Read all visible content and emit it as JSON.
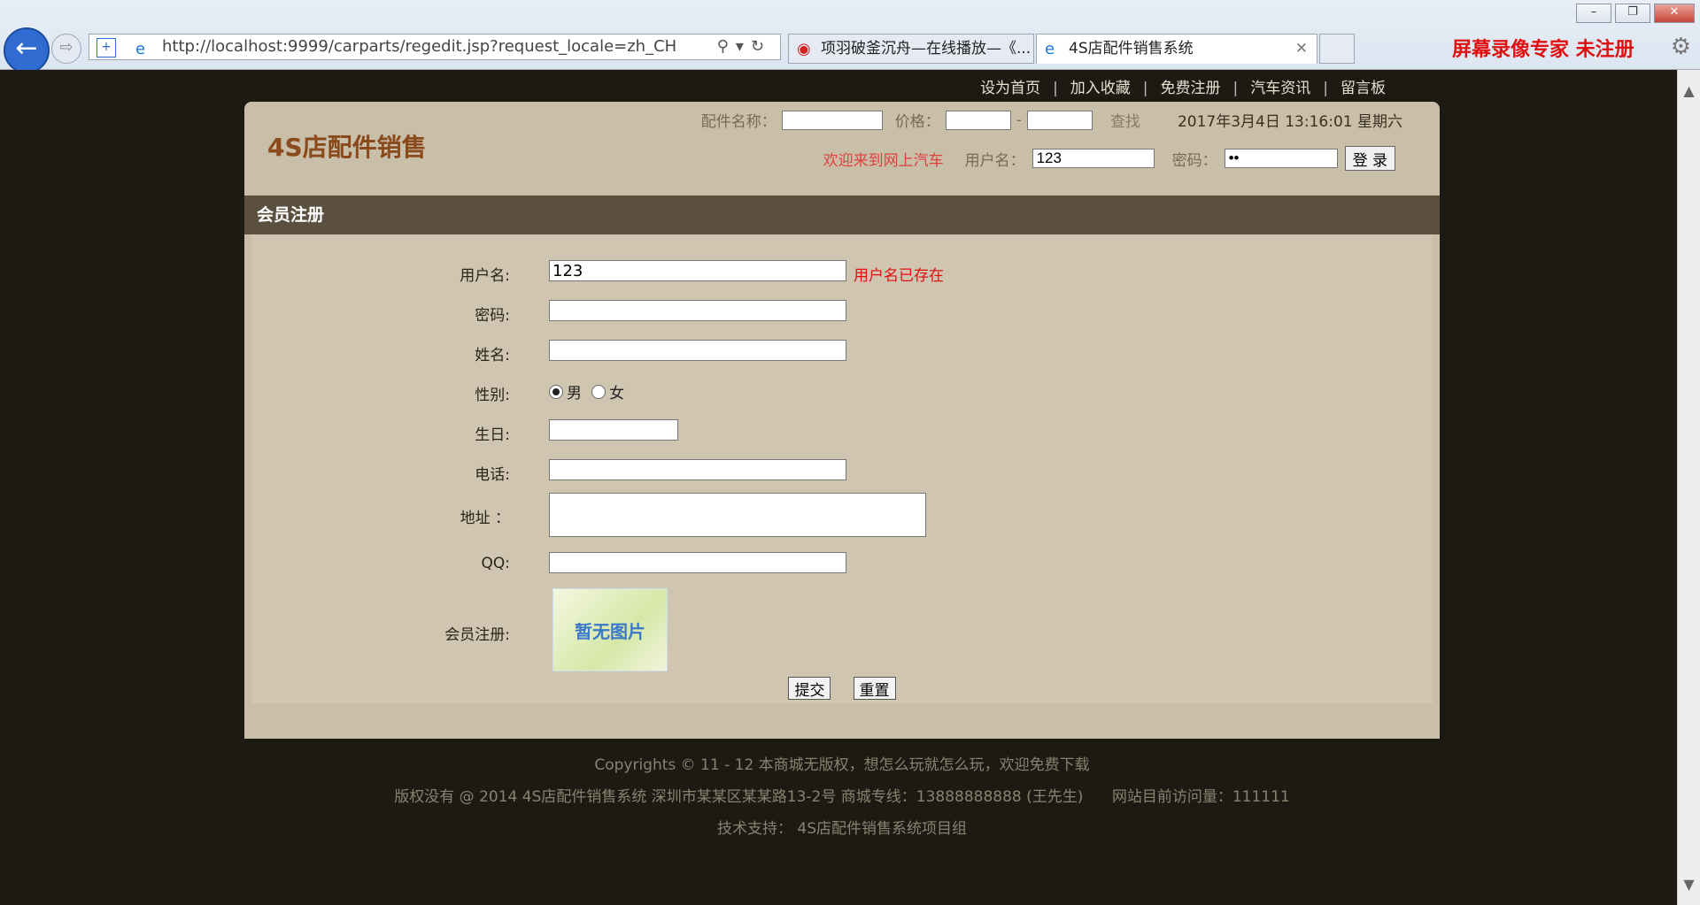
{
  "browser": {
    "url": "http://localhost:9999/carparts/regedit.jsp?request_locale=zh_CH",
    "tabs": [
      {
        "label": "项羽破釜沉舟—在线播放—《..."
      },
      {
        "label": "4S店配件销售系统"
      }
    ],
    "recorder_watermark": "屏幕录像专家  未注册"
  },
  "topnav": [
    "设为首页",
    "加入收藏",
    "免费注册",
    "汽车资讯",
    "留言板"
  ],
  "site": {
    "title": "4S店配件销售",
    "search": {
      "name_label": "配件名称：",
      "price_label": "价格：",
      "dash": "-",
      "find": "查找",
      "datetime": "2017年3月4日 13:16:01  星期六"
    },
    "login": {
      "welcome": "欢迎来到网上汽车",
      "user_label": "用户名：",
      "user_value": "123",
      "pass_label": "密码：",
      "pass_value": "••",
      "button": "登 录"
    }
  },
  "section_title": "会员注册",
  "form": {
    "username_label": "用户名:",
    "username_value": "123",
    "username_error": "用户名已存在",
    "password_label": "密码:",
    "name_label": "姓名:",
    "gender_label": "性别:",
    "gender_male": "男",
    "gender_female": "女",
    "birthday_label": "生日:",
    "phone_label": "电话:",
    "address_label": "地址 ：",
    "qq_label": "QQ:",
    "photo_label": "会员注册:",
    "photo_placeholder": "暂无图片",
    "submit": "提交",
    "reset": "重置"
  },
  "footer": {
    "line1": "Copyrights © 11 - 12 本商城无版权，想怎么玩就怎么玩，欢迎免费下载",
    "line2": "版权没有 @ 2014 4S店配件销售系统 深圳市某某区某某路13-2号 商城专线：13888888888 (王先生)      网站目前访问量：111111",
    "line3": "技术支持： 4S店配件销售系统项目组"
  }
}
